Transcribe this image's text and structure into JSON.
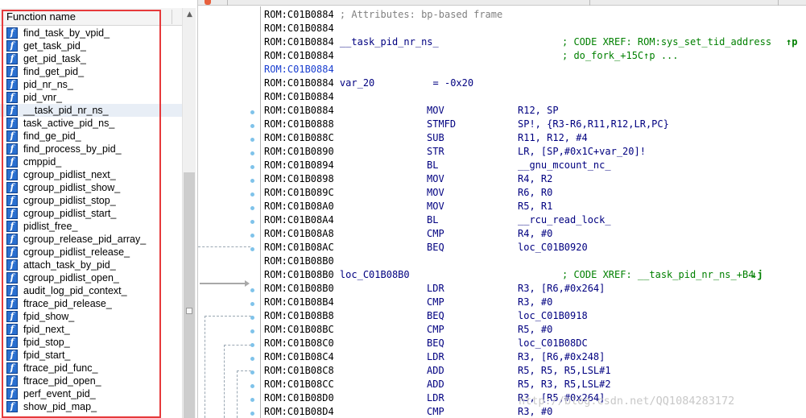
{
  "functions_panel": {
    "header": "Function name",
    "icon_glyph": "f",
    "selected_index": 6,
    "items": [
      "find_task_by_vpid_",
      "get_task_pid_",
      "get_pid_task_",
      "find_get_pid_",
      "pid_nr_ns_",
      "pid_vnr_",
      "__task_pid_nr_ns_",
      "task_active_pid_ns_",
      "find_ge_pid_",
      "find_process_by_pid_",
      "cmppid_",
      "cgroup_pidlist_next_",
      "cgroup_pidlist_show_",
      "cgroup_pidlist_stop_",
      "cgroup_pidlist_start_",
      "pidlist_free_",
      "cgroup_release_pid_array_",
      "cgroup_pidlist_release_",
      "attach_task_by_pid_",
      "cgroup_pidlist_open_",
      "audit_log_pid_context_",
      "ftrace_pid_release_",
      "fpid_show_",
      "fpid_next_",
      "fpid_stop_",
      "fpid_start_",
      "ftrace_pid_func_",
      "ftrace_pid_open_",
      "perf_event_pid_",
      "show_pid_map_"
    ]
  },
  "scrollbar": {
    "up_arrow": "▲"
  },
  "disassembly": {
    "lines": [
      {
        "addr": "ROM:C01B0884",
        "text": " ; Attributes: bp-based frame",
        "kind": "comment"
      },
      {
        "addr": "ROM:C01B0884",
        "text": "",
        "kind": "blank"
      },
      {
        "addr": "ROM:C01B0884",
        "label": " __task_pid_nr_ns_",
        "xref": "; CODE XREF: ROM:sys_set_tid_address",
        "arrow": "↑p",
        "kind": "labelxref"
      },
      {
        "addr": "ROM:C01B0884",
        "xref": "; do_fork_+15C↑p ...",
        "kind": "xrefonly"
      },
      {
        "addr": "ROM:C01B0884",
        "text": "",
        "kind": "blank",
        "blue": true
      },
      {
        "addr": "ROM:C01B0884",
        "text": " var_20          = -0x20",
        "kind": "var"
      },
      {
        "addr": "ROM:C01B0884",
        "text": "",
        "kind": "blank"
      },
      {
        "addr": "ROM:C01B0884",
        "mnem": "MOV",
        "ops": "R12, SP",
        "kind": "insn"
      },
      {
        "addr": "ROM:C01B0888",
        "mnem": "STMFD",
        "ops": "SP!, {R3-R6,R11,R12,LR,PC}",
        "kind": "insn"
      },
      {
        "addr": "ROM:C01B088C",
        "mnem": "SUB",
        "ops": "R11, R12, #4",
        "kind": "insn"
      },
      {
        "addr": "ROM:C01B0890",
        "mnem": "STR",
        "ops": "LR, [SP,#0x1C+var_20]!",
        "kind": "insn"
      },
      {
        "addr": "ROM:C01B0894",
        "mnem": "BL",
        "ops": "__gnu_mcount_nc_",
        "kind": "insn"
      },
      {
        "addr": "ROM:C01B0898",
        "mnem": "MOV",
        "ops": "R4, R2",
        "kind": "insn"
      },
      {
        "addr": "ROM:C01B089C",
        "mnem": "MOV",
        "ops": "R6, R0",
        "kind": "insn"
      },
      {
        "addr": "ROM:C01B08A0",
        "mnem": "MOV",
        "ops": "R5, R1",
        "kind": "insn"
      },
      {
        "addr": "ROM:C01B08A4",
        "mnem": "BL",
        "ops": "__rcu_read_lock_",
        "kind": "insn"
      },
      {
        "addr": "ROM:C01B08A8",
        "mnem": "CMP",
        "ops": "R4, #0",
        "kind": "insn"
      },
      {
        "addr": "ROM:C01B08AC",
        "mnem": "BEQ",
        "ops": "loc_C01B0920",
        "kind": "insn"
      },
      {
        "addr": "ROM:C01B08B0",
        "text": "",
        "kind": "blank"
      },
      {
        "addr": "ROM:C01B08B0",
        "label": " loc_C01B08B0",
        "xref": "; CODE XREF: __task_pid_nr_ns_+B4",
        "arrow": "↓j",
        "kind": "labelxref"
      },
      {
        "addr": "ROM:C01B08B0",
        "mnem": "LDR",
        "ops": "R3, [R6,#0x264]",
        "kind": "insn"
      },
      {
        "addr": "ROM:C01B08B4",
        "mnem": "CMP",
        "ops": "R3, #0",
        "kind": "insn"
      },
      {
        "addr": "ROM:C01B08B8",
        "mnem": "BEQ",
        "ops": "loc_C01B0918",
        "kind": "insn"
      },
      {
        "addr": "ROM:C01B08BC",
        "mnem": "CMP",
        "ops": "R5, #0",
        "kind": "insn"
      },
      {
        "addr": "ROM:C01B08C0",
        "mnem": "BEQ",
        "ops": "loc_C01B08DC",
        "kind": "insn"
      },
      {
        "addr": "ROM:C01B08C4",
        "mnem": "LDR",
        "ops": "R3, [R6,#0x248]",
        "kind": "insn"
      },
      {
        "addr": "ROM:C01B08C8",
        "mnem": "ADD",
        "ops": "R5, R5, R5,LSL#1",
        "kind": "insn"
      },
      {
        "addr": "ROM:C01B08CC",
        "mnem": "ADD",
        "ops": "R5, R3, R5,LSL#2",
        "kind": "insn"
      },
      {
        "addr": "ROM:C01B08D0",
        "mnem": "LDR",
        "ops": "R3, [R5,#0x264]",
        "kind": "insn"
      },
      {
        "addr": "ROM:C01B08D4",
        "mnem": "CMP",
        "ops": "R3, #0",
        "kind": "insn"
      }
    ],
    "watermark": "http://blog.csdn.net/QQ1084283172"
  }
}
